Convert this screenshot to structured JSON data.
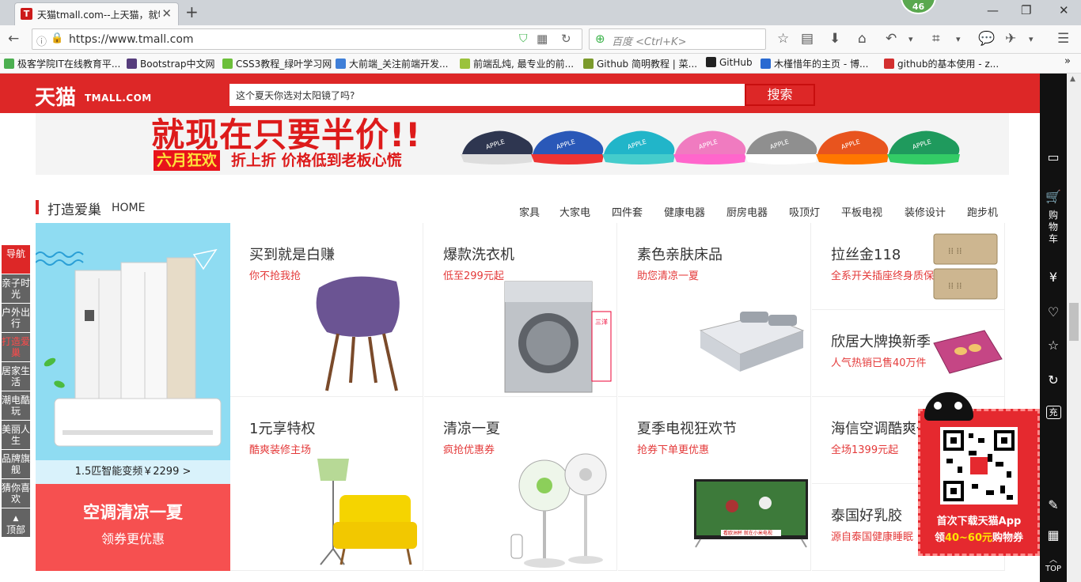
{
  "browser": {
    "tab_title": "天猫tmall.com--上天猫，就够了",
    "tab_favicon": "T",
    "notification_count": "46",
    "url": "https://www.tmall.com",
    "search_placeholder": "百度 <Ctrl+K>",
    "bookmarks": [
      {
        "label": "极客学院IT在线教育平...",
        "color": "#4caf50"
      },
      {
        "label": "Bootstrap中文网",
        "color": "#563d7c"
      },
      {
        "label": "CSS3教程_绿叶学习网",
        "color": "#6cbf3a"
      },
      {
        "label": "大前端_关注前端开发...",
        "color": "#3f7fd8"
      },
      {
        "label": "前端乱炖, 最专业的前...",
        "color": "#9bc23d"
      },
      {
        "label": "Github 简明教程 | 菜...",
        "color": "#7b9a2c"
      },
      {
        "label": "GitHub",
        "color": "#222222"
      },
      {
        "label": "木槿惜年的主页 - 博...",
        "color": "#2a6ad1"
      },
      {
        "label": "github的基本使用 - z...",
        "color": "#d32f2f"
      }
    ]
  },
  "site": {
    "logo_cn": "天猫",
    "logo_en": "TMALL.COM",
    "search_placeholder": "这个夏天你选对太阳镜了吗?",
    "search_button": "搜索"
  },
  "banner": {
    "headline": "就现在只要半价!!",
    "tag": "六月狂欢",
    "subtitle": "折上折 价格低到老板心慌",
    "shoe_colors": [
      "#2e3650",
      "#2a58b8",
      "#21b5c9",
      "#f07bc0",
      "#8f8f8f",
      "#e8541e",
      "#1f9a5d"
    ]
  },
  "section": {
    "title": "打造爱巢",
    "subtitle": "HOME",
    "categories": [
      "家具",
      "大家电",
      "四件套",
      "健康电器",
      "厨房电器",
      "吸顶灯",
      "平板电视",
      "装修设计",
      "跑步机"
    ]
  },
  "left_promo": {
    "caption": "1.5匹智能变频￥2299 >",
    "red_title": "空调清凉一夏",
    "red_sub": "领券更优惠"
  },
  "cards": [
    {
      "title": "买到就是白赚",
      "sub": "你不抢我抢"
    },
    {
      "title": "爆款洗衣机",
      "sub": "低至299元起"
    },
    {
      "title": "素色亲肤床品",
      "sub": "助您清凉一夏"
    },
    {
      "title": "拉丝金118",
      "sub": "全系开关插座终身质保"
    },
    {
      "title": "欣居大牌换新季",
      "sub": "人气热销已售40万件"
    },
    {
      "title": "1元享特权",
      "sub": "酷爽装修主场"
    },
    {
      "title": "清凉一夏",
      "sub": "疯抢优惠券"
    },
    {
      "title": "夏季电视狂欢节",
      "sub": "抢券下单更优惠"
    },
    {
      "title": "海信空调酷爽一夏",
      "sub": "全场1399元起"
    },
    {
      "title": "泰国好乳胶",
      "sub": "源自泰国健康睡眠"
    }
  ],
  "tv_screen_text": "看欧洲杯 就在小米电视",
  "washer_brand": "三洋",
  "sidenav": [
    {
      "label": "导航",
      "state": "red"
    },
    {
      "label": "亲子时光",
      "state": "normal"
    },
    {
      "label": "户外出行",
      "state": "normal"
    },
    {
      "label": "打造爱巢",
      "state": "current"
    },
    {
      "label": "居家生活",
      "state": "normal"
    },
    {
      "label": "潮电酷玩",
      "state": "normal"
    },
    {
      "label": "美丽人生",
      "state": "normal"
    },
    {
      "label": "品牌旗舰",
      "state": "normal"
    },
    {
      "label": "猜你喜欢",
      "state": "normal"
    },
    {
      "label": "顶部",
      "state": "normal"
    }
  ],
  "toolbar": {
    "cart_label": "购物车",
    "yen_icon": "¥",
    "recharge_label": "充",
    "top_label": "TOP"
  },
  "qr_popup": {
    "line1": "首次下载天猫App",
    "line2_pre": "领",
    "line2_amount": "40~60元",
    "line2_post": "购物券"
  }
}
